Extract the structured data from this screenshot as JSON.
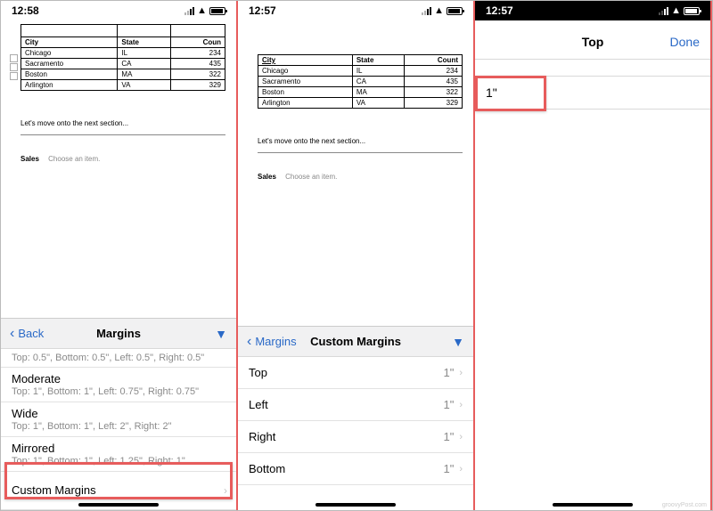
{
  "phones": [
    {
      "time": "12:58"
    },
    {
      "time": "12:57"
    },
    {
      "time": "12:57"
    }
  ],
  "doc": {
    "headers": [
      "City",
      "State",
      "Count"
    ],
    "headers_trunc": [
      "City",
      "State",
      "Coun"
    ],
    "rows": [
      {
        "city": "Chicago",
        "state": "IL",
        "count": 234
      },
      {
        "city": "Sacramento",
        "state": "CA",
        "count": 435
      },
      {
        "city": "Boston",
        "state": "MA",
        "count": 322
      },
      {
        "city": "Arlington",
        "state": "VA",
        "count": 329
      }
    ],
    "section_text": "Let's move onto the next section...",
    "sales_label": "Sales",
    "sales_placeholder": "Choose an item."
  },
  "margins_sheet": {
    "back_label": "Back",
    "title": "Margins",
    "truncated_row": "Top: 0.5\", Bottom: 0.5\", Left: 0.5\", Right: 0.5\"",
    "options": [
      {
        "name": "Moderate",
        "detail": "Top: 1\", Bottom: 1\", Left: 0.75\", Right: 0.75\""
      },
      {
        "name": "Wide",
        "detail": "Top: 1\", Bottom: 1\", Left: 2\", Right: 2\""
      },
      {
        "name": "Mirrored",
        "detail": "Top: 1\", Bottom: 1\", Left: 1.25\", Right: 1\""
      }
    ],
    "custom_label": "Custom Margins"
  },
  "custom_sheet": {
    "back_label": "Margins",
    "title": "Custom Margins",
    "items": [
      {
        "label": "Top",
        "value": "1\""
      },
      {
        "label": "Left",
        "value": "1\""
      },
      {
        "label": "Right",
        "value": "1\""
      },
      {
        "label": "Bottom",
        "value": "1\""
      }
    ]
  },
  "top_editor": {
    "title": "Top",
    "done": "Done",
    "value": "1\""
  },
  "chart_data": {
    "type": "table",
    "columns": [
      "City",
      "State",
      "Count"
    ],
    "rows": [
      [
        "Chicago",
        "IL",
        234
      ],
      [
        "Sacramento",
        "CA",
        435
      ],
      [
        "Boston",
        "MA",
        322
      ],
      [
        "Arlington",
        "VA",
        329
      ]
    ]
  }
}
